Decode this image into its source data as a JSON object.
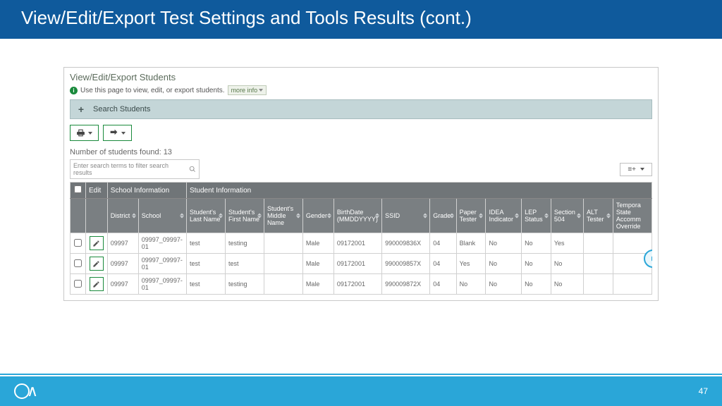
{
  "slide_title": "View/Edit/Export Test Settings and Tools Results (cont.)",
  "page_number": "47",
  "panel": {
    "title": "View/Edit/Export Students",
    "hint": "Use this page to view, edit, or export students.",
    "more_info": "more info"
  },
  "search_bar_label": "Search Students",
  "results_count": "Number of students found: 13",
  "filter_placeholder": "Enter search terms to filter search results",
  "columns_button_icon": "≡+",
  "table": {
    "groups": [
      {
        "label": "",
        "span": 1
      },
      {
        "label": "Edit",
        "span": 1
      },
      {
        "label": "School Information",
        "span": 2
      },
      {
        "label": "Student Information",
        "span": 13
      }
    ],
    "columns": [
      "",
      "",
      "District",
      "School",
      "Student's Last Name",
      "Student's First Name",
      "Student's Middle Name",
      "Gender",
      "BirthDate (MMDDYYYY)",
      "SSID",
      "Grade",
      "Paper Tester",
      "IDEA Indicator",
      "LEP Status",
      "Section 504",
      "ALT Tester",
      "Tempora State Accomm Override"
    ],
    "rows": [
      {
        "district": "09997",
        "school": "09997_09997-01",
        "last": "test",
        "first": "testing",
        "middle": "",
        "gender": "Male",
        "dob": "09172001",
        "ssid": "990009836X",
        "grade": "04",
        "paper": "Blank",
        "idea": "No",
        "lep": "No",
        "s504": "Yes",
        "alt": "",
        "temp": ""
      },
      {
        "district": "09997",
        "school": "09997_09997-01",
        "last": "test",
        "first": "test",
        "middle": "",
        "gender": "Male",
        "dob": "09172001",
        "ssid": "990009857X",
        "grade": "04",
        "paper": "Yes",
        "idea": "No",
        "lep": "No",
        "s504": "No",
        "alt": "",
        "temp": ""
      },
      {
        "district": "09997",
        "school": "09997_09997-01",
        "last": "test",
        "first": "testing",
        "middle": "",
        "gender": "Male",
        "dob": "09172001",
        "ssid": "990009872X",
        "grade": "04",
        "paper": "No",
        "idea": "No",
        "lep": "No",
        "s504": "No",
        "alt": "",
        "temp": ""
      }
    ]
  }
}
